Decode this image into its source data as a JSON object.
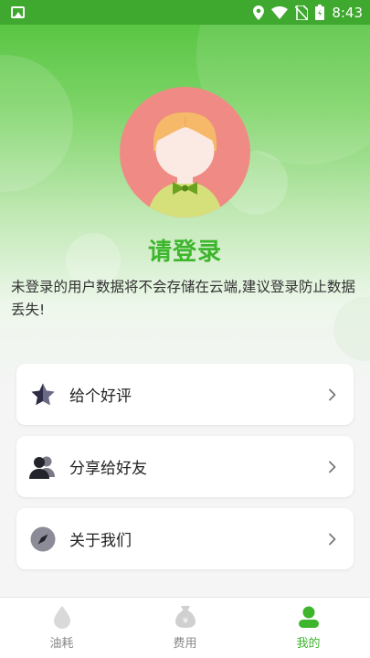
{
  "status_bar": {
    "time": "8:43",
    "icons": [
      "gallery-icon",
      "location-icon",
      "wifi-icon",
      "no-sim-icon",
      "battery-icon"
    ]
  },
  "colors": {
    "accent": "#3db52c",
    "status_bar": "#3fa82f",
    "avatar_bg": "#ef8b84"
  },
  "profile": {
    "avatar_icon": "user-avatar-icon",
    "title": "请登录",
    "description": "未登录的用户数据将不会存储在云端,建议登录防止数据丢失!"
  },
  "menu": [
    {
      "label": "给个好评",
      "icon": "star-icon"
    },
    {
      "label": "分享给好友",
      "icon": "users-icon"
    },
    {
      "label": "关于我们",
      "icon": "compass-icon"
    }
  ],
  "tabs": [
    {
      "label": "油耗",
      "icon": "drop-icon",
      "active": false
    },
    {
      "label": "费用",
      "icon": "money-bag-icon",
      "active": false
    },
    {
      "label": "我的",
      "icon": "user-icon",
      "active": true
    }
  ]
}
